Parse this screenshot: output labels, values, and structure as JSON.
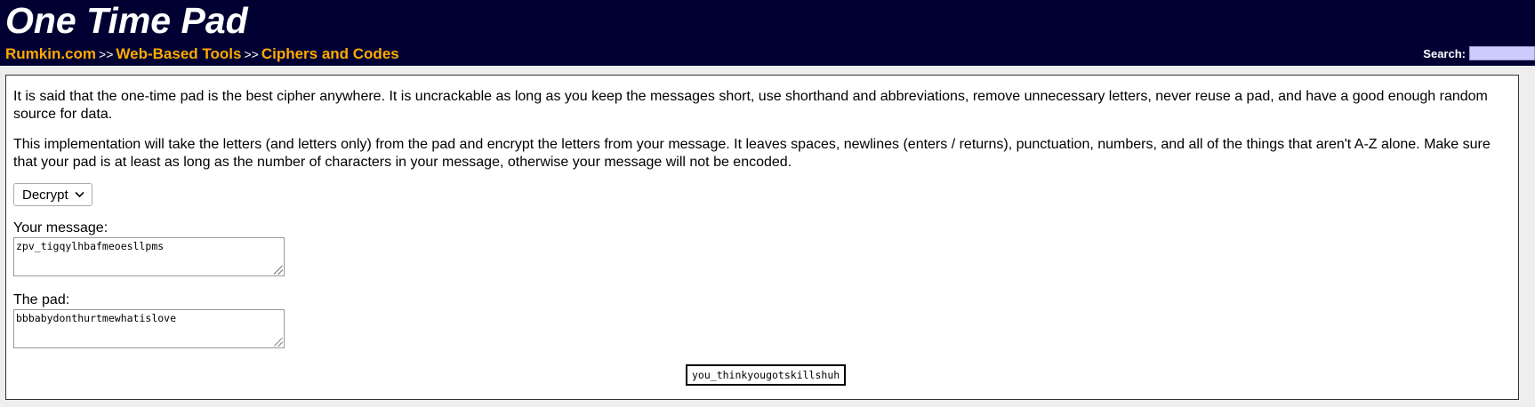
{
  "header": {
    "title": "One Time Pad",
    "breadcrumb": {
      "items": [
        "Rumkin.com",
        "Web-Based Tools",
        "Ciphers and Codes"
      ],
      "separator": ">>"
    },
    "search": {
      "label": "Search:",
      "value": ""
    }
  },
  "main": {
    "intro": "It is said that the one-time pad is the best cipher anywhere. It is uncrackable as long as you keep the messages short, use shorthand and abbreviations, remove unnecessary letters, never reuse a pad, and have a good enough random source for data.",
    "description": "This implementation will take the letters (and letters only) from the pad and encrypt the letters from your message. It leaves spaces, newlines (enters / returns), punctuation, numbers, and all of the things that aren't A-Z alone. Make sure that your pad is at least as long as the number of characters in your message, otherwise your message will not be encoded.",
    "mode": {
      "selected": "Decrypt",
      "icon": "chevron-down-icon"
    },
    "message": {
      "label": "Your message:",
      "value": "zpv_tigqylhbafmeoesllpms"
    },
    "pad": {
      "label": "The pad:",
      "value": "bbbabydonthurtmewhatislove"
    },
    "result": "you_thinkyougotskillshuh"
  },
  "colors": {
    "header_bg": "#000033",
    "link": "#ffaa00",
    "search_bg": "#ccccff"
  }
}
